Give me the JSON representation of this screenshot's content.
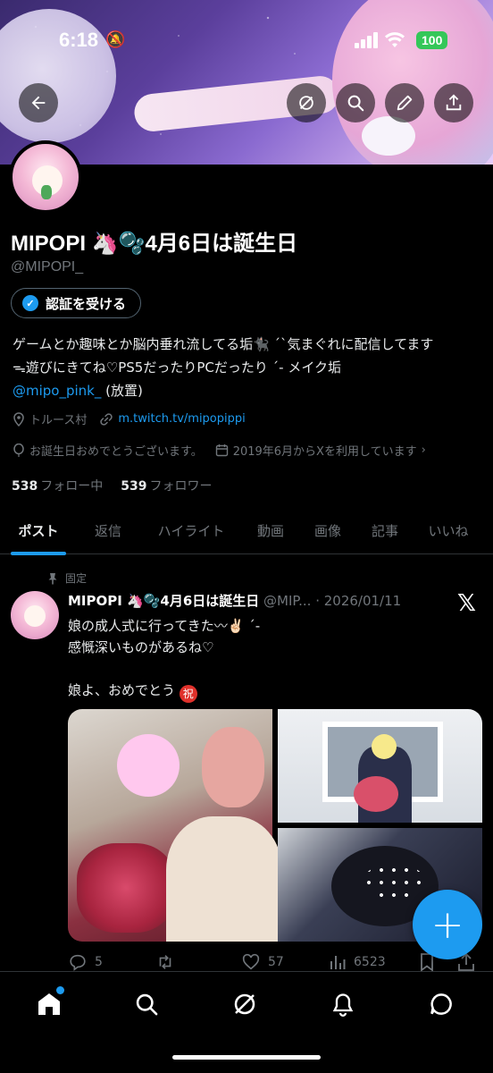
{
  "status_bar": {
    "time": "6:18",
    "battery": "100"
  },
  "profile": {
    "name": "MIPOPI 🦄🫧4月6日は誕生日",
    "handle": "@MIPOPI_",
    "verify_button": "認証を受ける",
    "bio_line1": "ゲームとか趣味とか脳内垂れ流してる垢🐈‍⬛ ˊˋ気まぐれに配信してます",
    "bio_line2": "ᯓ遊びにきてね♡PS5だったりPCだったり ˊ- メイク垢",
    "bio_mention": "@mipo_pink_",
    "bio_suffix": " (放置)",
    "location": "トルース村",
    "website": "m.twitch.tv/mipopippi",
    "birthday": "お誕生日おめでとうございます。",
    "joined": "2019年6月からXを利用しています",
    "following_count": "538",
    "following_label": "フォロー中",
    "followers_count": "539",
    "followers_label": "フォロワー"
  },
  "tabs": [
    {
      "label": "ポスト",
      "active": true
    },
    {
      "label": "返信"
    },
    {
      "label": "ハイライト"
    },
    {
      "label": "動画"
    },
    {
      "label": "画像"
    },
    {
      "label": "記事"
    },
    {
      "label": "いいね"
    }
  ],
  "post": {
    "pinned_label": "固定",
    "author_name": "MIPOPI 🦄🫧4月6日は誕生日",
    "author_meta": " @MIP... · 2026/01/11",
    "text": "娘の成人式に行ってきた〰︎✌🏻 ˊ-\n感慨深いものがあるね♡\n\n娘よ、おめでとう",
    "iwai": "祝",
    "replies": "5",
    "likes": "57",
    "views": "6523"
  },
  "colors": {
    "accent": "#1d9bf0",
    "background": "#000000",
    "muted": "#71767b"
  }
}
